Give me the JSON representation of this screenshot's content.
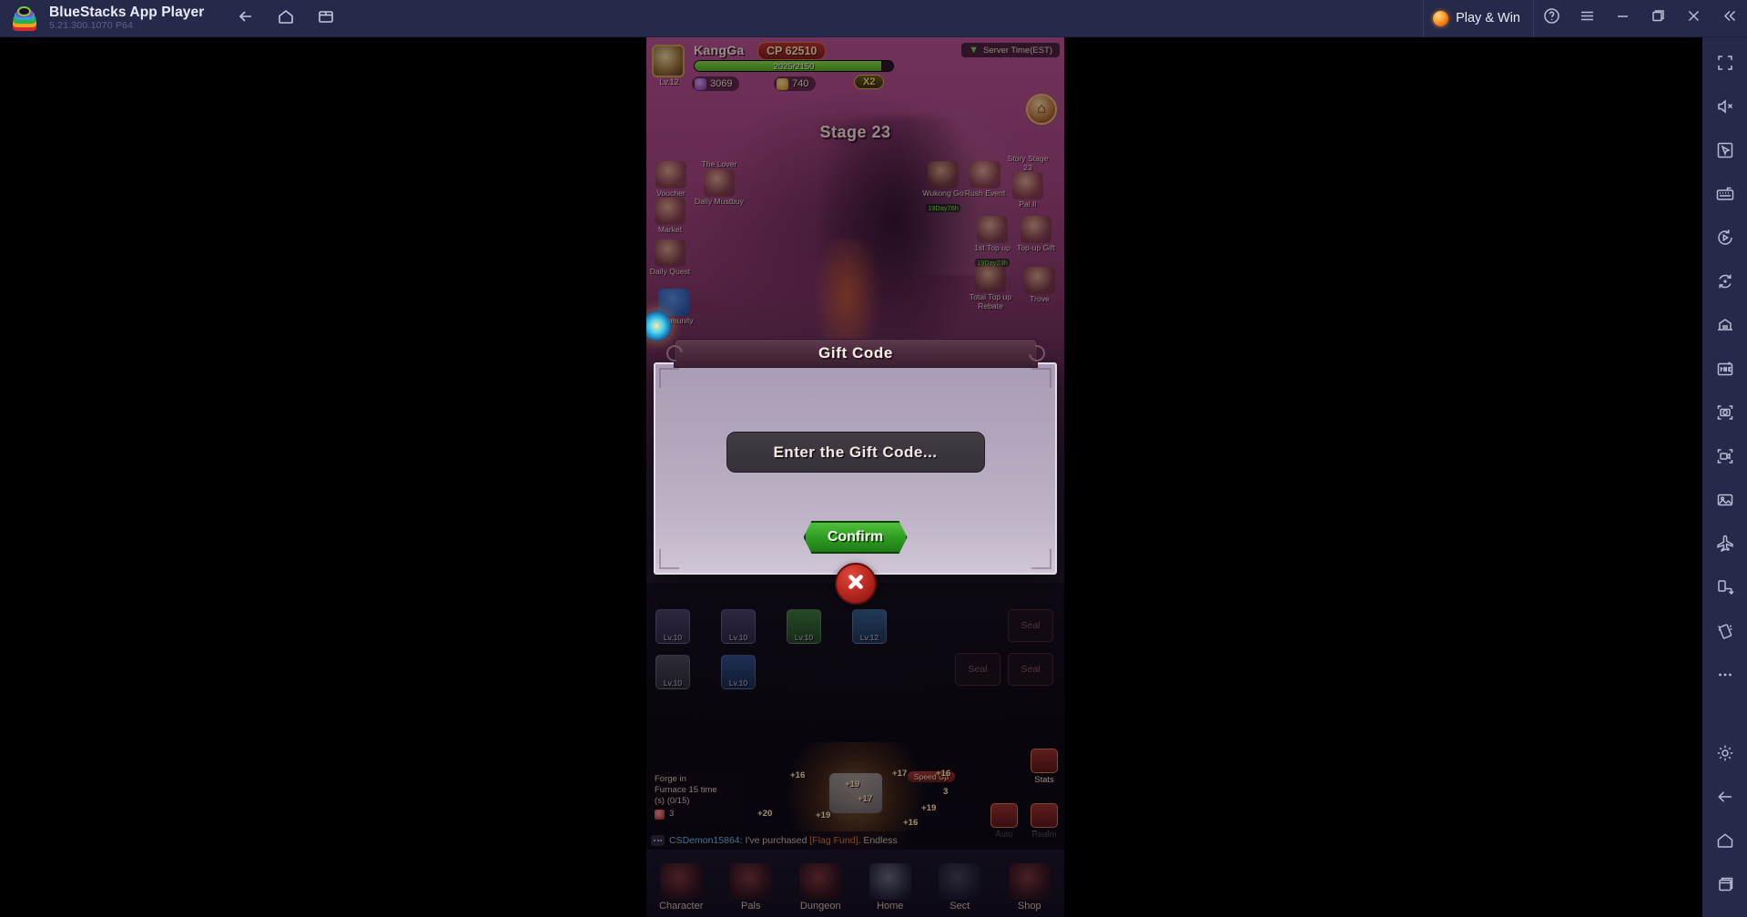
{
  "titlebar": {
    "app_title": "BlueStacks App Player",
    "version": "5.21.300.1070  P64",
    "logo_icon": "bluestacks-logo",
    "nav": [
      {
        "name": "back",
        "icon": "arrow-left-icon"
      },
      {
        "name": "home",
        "icon": "home-icon"
      },
      {
        "name": "multi-instance",
        "icon": "copy-windows-icon"
      }
    ],
    "play_and_win": {
      "label": "Play & Win",
      "icon": "orb-icon"
    },
    "window_buttons": [
      {
        "name": "help",
        "icon": "question-circle-icon"
      },
      {
        "name": "menu",
        "icon": "hamburger-icon"
      },
      {
        "name": "minimize",
        "icon": "minimize-icon"
      },
      {
        "name": "maximize",
        "icon": "restore-icon"
      },
      {
        "name": "close",
        "icon": "close-icon"
      },
      {
        "name": "collapse-sidebar",
        "icon": "double-chevron-left-icon"
      }
    ]
  },
  "sidebar": {
    "items": [
      {
        "name": "fullscreen",
        "icon": "fullscreen-icon"
      },
      {
        "name": "volume",
        "icon": "speaker-mute-icon"
      },
      {
        "name": "pointer-mode",
        "icon": "cursor-box-icon"
      },
      {
        "name": "keyboard-controls",
        "icon": "keyboard-icon"
      },
      {
        "name": "macro-recorder",
        "icon": "play-circle-icon"
      },
      {
        "name": "sync-operations",
        "icon": "sync-circle-icon"
      },
      {
        "name": "multi-instance-manager",
        "icon": "instance-manager-icon"
      },
      {
        "name": "install-apk",
        "icon": "apk-install-icon"
      },
      {
        "name": "screenshot",
        "icon": "camera-icon"
      },
      {
        "name": "record-screen",
        "icon": "video-camera-icon"
      },
      {
        "name": "media-manager",
        "icon": "image-folder-icon"
      },
      {
        "name": "eco-mode",
        "icon": "airplane-icon"
      },
      {
        "name": "rotate",
        "icon": "rotate-device-icon"
      },
      {
        "name": "shake",
        "icon": "shake-icon"
      },
      {
        "name": "more-options",
        "icon": "ellipsis-icon"
      }
    ],
    "bottom_items": [
      {
        "name": "settings",
        "icon": "gear-icon"
      },
      {
        "name": "android-back",
        "icon": "arrow-left-icon"
      },
      {
        "name": "android-home",
        "icon": "home-icon"
      },
      {
        "name": "android-recents",
        "icon": "recents-icon"
      }
    ]
  },
  "game": {
    "hud": {
      "player_name": "KangGa",
      "cp_label": "CP  62510",
      "avatar_level": "Lv.12",
      "xp_text": "2025/2150",
      "resource1": "3069",
      "resource2": "740",
      "speed_badge": "X2",
      "server_time": "Server Time(EST)",
      "home_icon": "home-icon",
      "stage": "Stage 23"
    },
    "left_events": [
      {
        "label": "Voucher",
        "timer": ""
      },
      {
        "label": "Market",
        "timer": ""
      },
      {
        "label": "Daily\nQuest",
        "timer": ""
      },
      {
        "label": "Community",
        "timer": ""
      }
    ],
    "left_events_flat": {
      "voucher": "Voucher",
      "the_lover": "The Lover",
      "daily_mustbuy": "Daily Mustbuy",
      "market": "Market",
      "daily_quest": "Daily Quest",
      "community": "Community"
    },
    "right_events": {
      "wukong_go": "Wukong Go",
      "wukong_timer": "19Day76h",
      "rush_event": "Rush Event",
      "story_stage": "Story Stage 23",
      "pal": "Pal II",
      "first_topup": "1st Top up",
      "first_topup_timer": "19Day23h",
      "topup_gift": "Top-up Gift",
      "total_rebate": "Total Top up Rebate",
      "trove": "Trove"
    },
    "equipment": {
      "slot_levels": [
        "Lv.10",
        "Lv.10",
        "Lv.10",
        "Lv.12",
        "Lv.10",
        "Lv.10"
      ],
      "seal_label": "Seal",
      "seal_count": 3
    },
    "forge": {
      "info_line1": "Forge in",
      "info_line2": "Furnace 15 time",
      "info_line3": "(s) (0/15)",
      "gem_count": "3",
      "speed_up": "Speed Up",
      "stats": "Stats",
      "auto": "Auto",
      "realm": "Realm",
      "enhancements": [
        "+16",
        "+19",
        "+17",
        "+16",
        "+20",
        "+19",
        "+19",
        "+16",
        "+16",
        "+17",
        "3"
      ]
    },
    "chat": {
      "user": "CSDemon15864:",
      "text_a": " I've purchased ",
      "item": "[Flag Fund]",
      "text_b": ". Endless"
    },
    "bottom_nav": [
      {
        "label": "Character",
        "icon": "character-icon"
      },
      {
        "label": "Pals",
        "icon": "pals-icon"
      },
      {
        "label": "Dungeon",
        "icon": "dungeon-icon"
      },
      {
        "label": "Home",
        "icon": "home-icon"
      },
      {
        "label": "Sect",
        "icon": "sect-icon"
      },
      {
        "label": "Shop",
        "icon": "shop-icon"
      }
    ],
    "modal": {
      "title": "Gift Code",
      "input_placeholder": "Enter the Gift Code...",
      "confirm_label": "Confirm",
      "close_icon": "close-x-icon"
    }
  },
  "colors": {
    "titlebar_bg": "#262a4a",
    "accent_orange": "#ff9f2e",
    "confirm_green": "#2f9c22",
    "close_red": "#bd2a22",
    "xp_green": "#4fae18"
  }
}
